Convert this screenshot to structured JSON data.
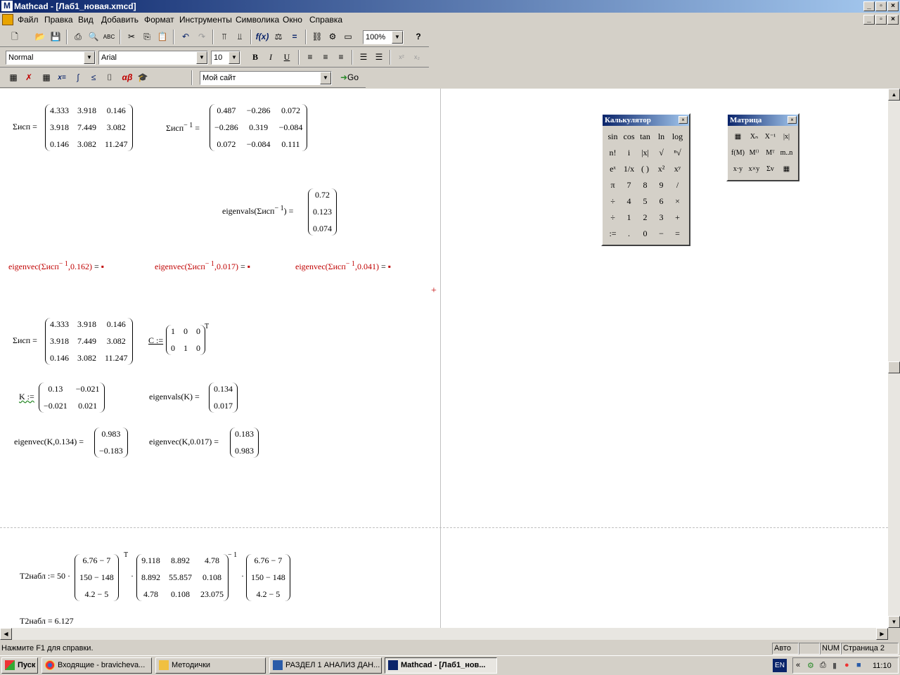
{
  "window": {
    "title": "Mathcad - [Лаб1_новая.xmcd]"
  },
  "menu": [
    "Файл",
    "Правка",
    "Вид",
    "Добавить",
    "Формат",
    "Инструменты",
    "Символика",
    "Окно",
    "Справка"
  ],
  "toolbar": {
    "zoom": "100%",
    "style": "Normal",
    "font": "Arial",
    "size": "10",
    "site": "Мой сайт",
    "go": "Go",
    "bold": "B",
    "italic": "I",
    "underline": "U"
  },
  "doc": {
    "sigma_label": "Σисп =",
    "sigma_matrix": [
      [
        "4.333",
        "3.918",
        "0.146"
      ],
      [
        "3.918",
        "7.449",
        "3.082"
      ],
      [
        "0.146",
        "3.082",
        "11.247"
      ]
    ],
    "sigma_inv_label": "Σисп",
    "sigma_inv_exp": "− 1",
    "sigma_inv_eq": "=",
    "sigma_inv_matrix": [
      [
        "0.487",
        "−0.286",
        "0.072"
      ],
      [
        "−0.286",
        "0.319",
        "−0.084"
      ],
      [
        "0.072",
        "−0.084",
        "0.111"
      ]
    ],
    "eigenvals_label": "eigenvals",
    "eigenvals_arg": "Σисп",
    "eigenvals_exp": "− 1",
    "eigenvals_eq": "=",
    "eigenvals_vec": [
      "0.72",
      "0.123",
      "0.074"
    ],
    "eigenvec1_a": "eigenvec",
    "eigenvec1_b": "Σисп",
    "eigenvec1_exp": "− 1",
    "eigenvec1_c": ",0.162",
    "eigenvec2_c": ",0.017",
    "eigenvec3_c": ",0.041",
    "eq": "=",
    "sigma2_label": "Σисп =",
    "sigma2_matrix": [
      [
        "4.333",
        "3.918",
        "0.146"
      ],
      [
        "3.918",
        "7.449",
        "3.082"
      ],
      [
        "0.146",
        "3.082",
        "11.247"
      ]
    ],
    "c_label": "C :=",
    "c_matrix": [
      [
        "1",
        "0",
        "0"
      ],
      [
        "0",
        "1",
        "0"
      ]
    ],
    "transpose": "T",
    "k_label": "K :=",
    "k_matrix": [
      [
        "0.13",
        "−0.021"
      ],
      [
        "−0.021",
        "0.021"
      ]
    ],
    "eigvals_k_label": "eigenvals(K) =",
    "eigvals_k": [
      "0.134",
      "0.017"
    ],
    "eigvec_k1_label": "eigenvec(K,0.134) =",
    "eigvec_k1": [
      "0.983",
      "−0.183"
    ],
    "eigvec_k2_label": "eigenvec(K,0.017) =",
    "eigvec_k2": [
      "0.183",
      "0.983"
    ],
    "t2_label": "T2набл := 50 ·",
    "t2_vec": [
      "6.76 − 7",
      "150 − 148",
      "4.2 − 5"
    ],
    "t2_mid": [
      [
        "9.118",
        "8.892",
        "4.78"
      ],
      [
        "8.892",
        "55.857",
        "0.108"
      ],
      [
        "4.78",
        "0.108",
        "23.075"
      ]
    ],
    "t2_inv": "− 1",
    "dot": "·",
    "t2_result": "T2набл = 6.127"
  },
  "calc": {
    "title": "Калькулятор",
    "keys": [
      "sin",
      "cos",
      "tan",
      "ln",
      "log",
      "n!",
      "i",
      "|x|",
      "√",
      "ⁿ√",
      "eˣ",
      "1/x",
      "( )",
      "x²",
      "xʸ",
      "π",
      "7",
      "8",
      "9",
      "/",
      "÷",
      "4",
      "5",
      "6",
      "×",
      "÷",
      "1",
      "2",
      "3",
      "+",
      ":=",
      ".",
      "0",
      "−",
      "="
    ]
  },
  "matrix": {
    "title": "Матрица",
    "keys": [
      "▦",
      "Xₙ",
      "X⁻¹",
      "|x|",
      "f(M)",
      "M⁽⁾",
      "Mᵀ",
      "m..n",
      "x·y",
      "x×y",
      "Σv",
      "▦"
    ]
  },
  "status": {
    "help": "Нажмите F1 для справки.",
    "auto": "Авто",
    "num": "NUM",
    "page": "Страница 2"
  },
  "taskbar": {
    "start": "Пуск",
    "tasks": [
      "Входящие - bravicheva...",
      "Методички",
      "РАЗДЕЛ 1 АНАЛИЗ ДАН...",
      "Mathcad - [Лаб1_нов..."
    ],
    "lang": "EN",
    "time": "11:10"
  }
}
